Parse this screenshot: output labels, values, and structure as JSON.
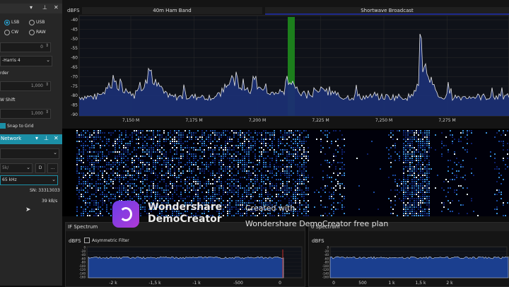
{
  "radio_panel": {
    "modes": [
      "LSB",
      "USB",
      "CW",
      "RAW"
    ],
    "selected_mode": "LSB",
    "input_value_1": "0",
    "window_select": "-Harris 4",
    "label_order": "rder",
    "input_value_2": "1,000",
    "label_shift": "W Shift",
    "input_value_3": "1,000",
    "snap_label": "Snap to Grid"
  },
  "network_panel": {
    "title": "Network",
    "field_1": "",
    "field_2": "5k/",
    "field_3": "65 kHz",
    "btn_d": "D",
    "btn_dots": "...",
    "sn": "SN: 33313033",
    "rate": "39 kB/s"
  },
  "spectrum": {
    "unit_label": "dBFS",
    "band_1": "40m Ham Band",
    "band_2": "Shortwave Broadcast",
    "y_ticks": [
      "-40",
      "-45",
      "-50",
      "-55",
      "-60",
      "-65",
      "-70",
      "-75",
      "-80",
      "-85",
      "-90"
    ],
    "x_ticks": [
      "7,150 M",
      "7,175 M",
      "7,200 M",
      "7,225 M",
      "7,250 M",
      "7,275 M"
    ]
  },
  "watermark": {
    "brand_line_1": "Wondershare",
    "brand_line_2": "DemoCreator",
    "created_with": "Created with",
    "plan_text": "Wondershare DemoCreator free plan"
  },
  "if_spectrum": {
    "title": "IF Spectrum",
    "unit_label": "dBFS",
    "asymmetric_label": "Asymmetric Filter",
    "y_ticks": [
      "0",
      "-20",
      "-40",
      "-60",
      "-80",
      "-100",
      "-120",
      "-140",
      "-160"
    ],
    "x_ticks": [
      "-2 k",
      "-1,5 k",
      "-1 k",
      "-500",
      "0"
    ]
  },
  "af_spectrum": {
    "title": "o Spectrum",
    "unit_label": "dBFS",
    "y_ticks": [
      "0",
      "-20",
      "-40",
      "-60",
      "-80",
      "-100",
      "-120",
      "-140",
      "-160"
    ],
    "x_ticks": [
      "0",
      "500",
      "1 k",
      "1,5 k",
      "2 k"
    ]
  },
  "colors": {
    "accent_teal": "#1b8fa6",
    "spectrum_fill": "#1b2f72",
    "trace": "#e6e6e6",
    "marker_green": "#1c7f1c",
    "background": "#0d0d0d"
  }
}
